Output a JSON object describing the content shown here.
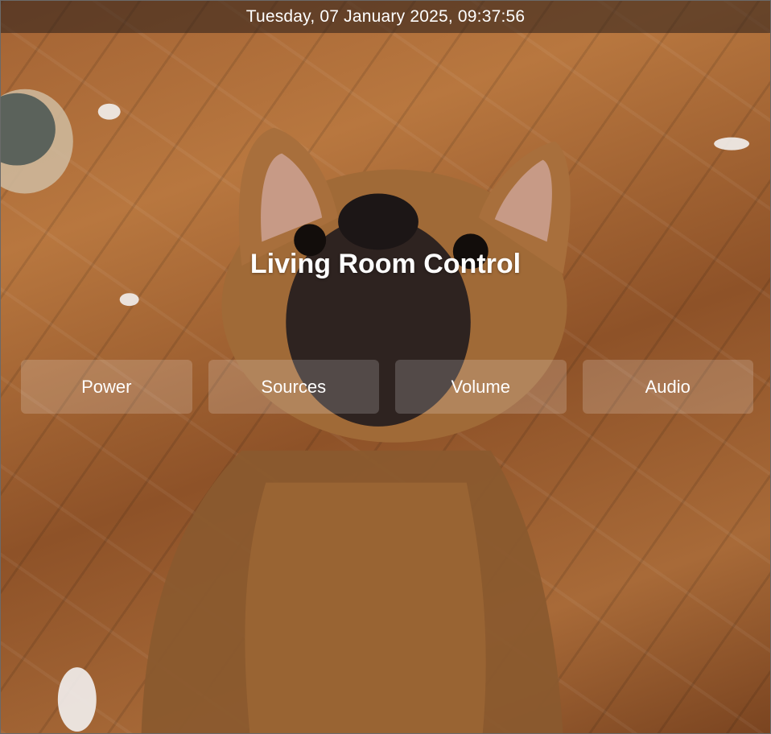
{
  "clock": {
    "text": "Tuesday, 07 January 2025, 09:37:56"
  },
  "room": {
    "title": "Living Room Control"
  },
  "buttons": [
    {
      "label": "Power"
    },
    {
      "label": "Sources"
    },
    {
      "label": "Volume"
    },
    {
      "label": "Audio"
    }
  ],
  "background": {
    "image_subject": "dog-photo"
  }
}
